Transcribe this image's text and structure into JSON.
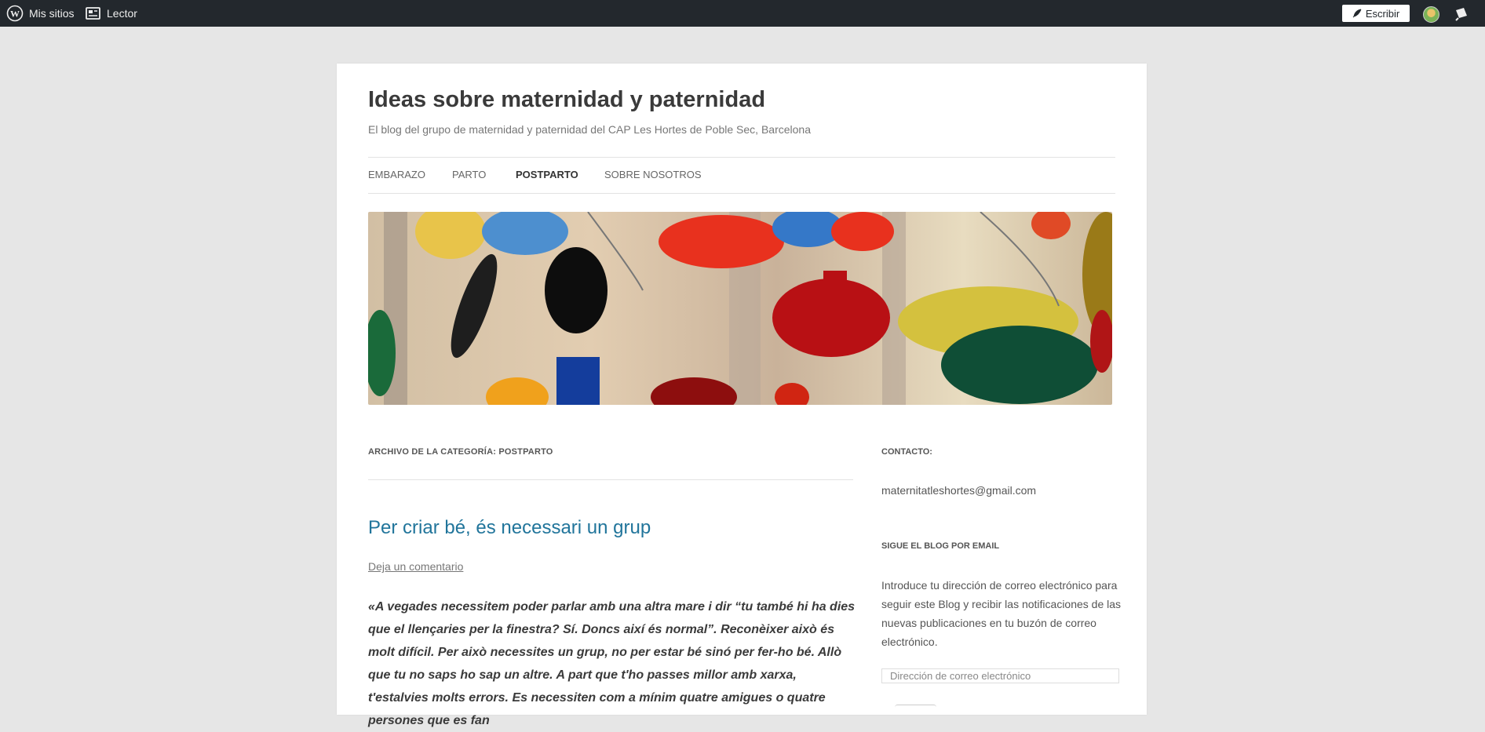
{
  "adminbar": {
    "my_sites": "Mis sitios",
    "reader": "Lector",
    "write": "Escribir"
  },
  "site": {
    "title": "Ideas sobre maternidad y paternidad",
    "description": "El blog del grupo de maternidad y paternidad del CAP Les Hortes de Poble Sec, Barcelona"
  },
  "nav": {
    "items": [
      {
        "label": "EMBARAZO"
      },
      {
        "label": "PARTO"
      },
      {
        "label": "POSTPARTO",
        "current": true
      },
      {
        "label": "SOBRE NOSOTROS"
      }
    ]
  },
  "content": {
    "archive_title": "ARCHIVO DE LA CATEGORÍA: POSTPARTO",
    "post_title": "Per criar bé, és necessari un grup",
    "comment_link": "Deja un comentario",
    "post_excerpt": "«A vegades necessitem poder parlar amb una altra mare i dir “tu també hi ha dies que el llençaries per la finestra? Sí. Doncs així és normal”. Reconèixer això és molt difícil. Per això necessites un grup, no per estar bé sinó per fer-ho bé. Allò que tu no saps ho sap un altre. A part que t'ho passes millor amb xarxa, t'estalvies molts errors. Es necessiten com a mínim quatre amigues o quatre persones que es fan"
  },
  "sidebar": {
    "contact_title": "CONTACTO:",
    "contact_email": "maternitatleshortes@gmail.com",
    "follow_title": "SIGUE EL BLOG POR EMAIL",
    "follow_text": "Introduce tu dirección de correo electrónico para seguir este Blog y recibir las notificaciones de las nuevas publicaciones en tu buzón de correo electrónico.",
    "email_placeholder": "Dirección de correo electrónico"
  },
  "colors": {
    "adminbar_bg": "#23282d",
    "link": "#21759b",
    "page_bg": "#e6e6e6"
  }
}
